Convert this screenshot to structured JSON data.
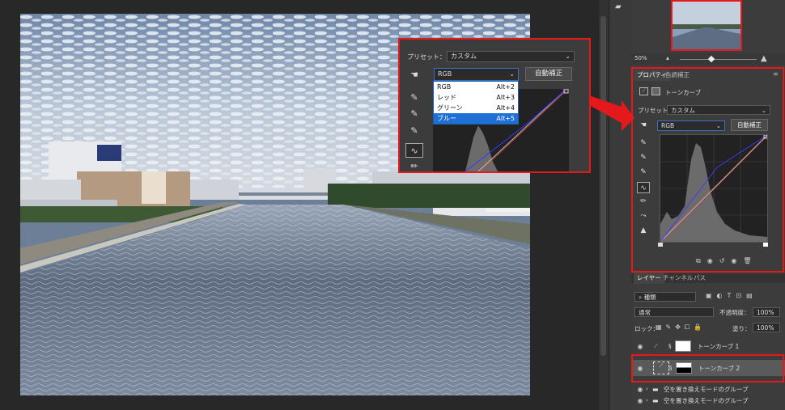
{
  "curves_popup": {
    "preset_label": "プリセット：",
    "preset_value": "カスタム",
    "channel_value": "RGB",
    "auto_button": "自動補正",
    "channel_menu": [
      {
        "label": "RGB",
        "shortcut": "Alt+2"
      },
      {
        "label": "レッド",
        "shortcut": "Alt+3"
      },
      {
        "label": "グリーン",
        "shortcut": "Alt+4"
      },
      {
        "label": "ブルー",
        "shortcut": "Alt+5",
        "highlighted": true
      }
    ]
  },
  "navigator": {
    "zoom": "50%"
  },
  "properties": {
    "tabs": [
      "プロパティ",
      "色調補正"
    ],
    "adjustment_title": "トーンカーブ",
    "preset_label": "プリセット：",
    "preset_value": "カスタム",
    "channel_value": "RGB",
    "auto_button": "自動補正"
  },
  "layers_panel": {
    "tabs": [
      "レイヤー",
      "チャンネル",
      "パス"
    ],
    "filter_kind": "種類",
    "blend_mode": "通常",
    "opacity_label": "不透明度：",
    "opacity_value": "100%",
    "lock_label": "ロック：",
    "fill_label": "塗り：",
    "fill_value": "100%",
    "layers": [
      {
        "name": "トーンカーブ 1",
        "selected": false
      },
      {
        "name": "トーンカーブ 2",
        "selected": true
      },
      {
        "name": "空を置き換えモードのグループ",
        "selected": false
      },
      {
        "name": "空を置き換えモードのグループ",
        "selected": false
      }
    ]
  },
  "colors": {
    "highlight": "#e3191b",
    "menu_highlight": "#1e6fd6",
    "panel": "#3c3c3c"
  }
}
